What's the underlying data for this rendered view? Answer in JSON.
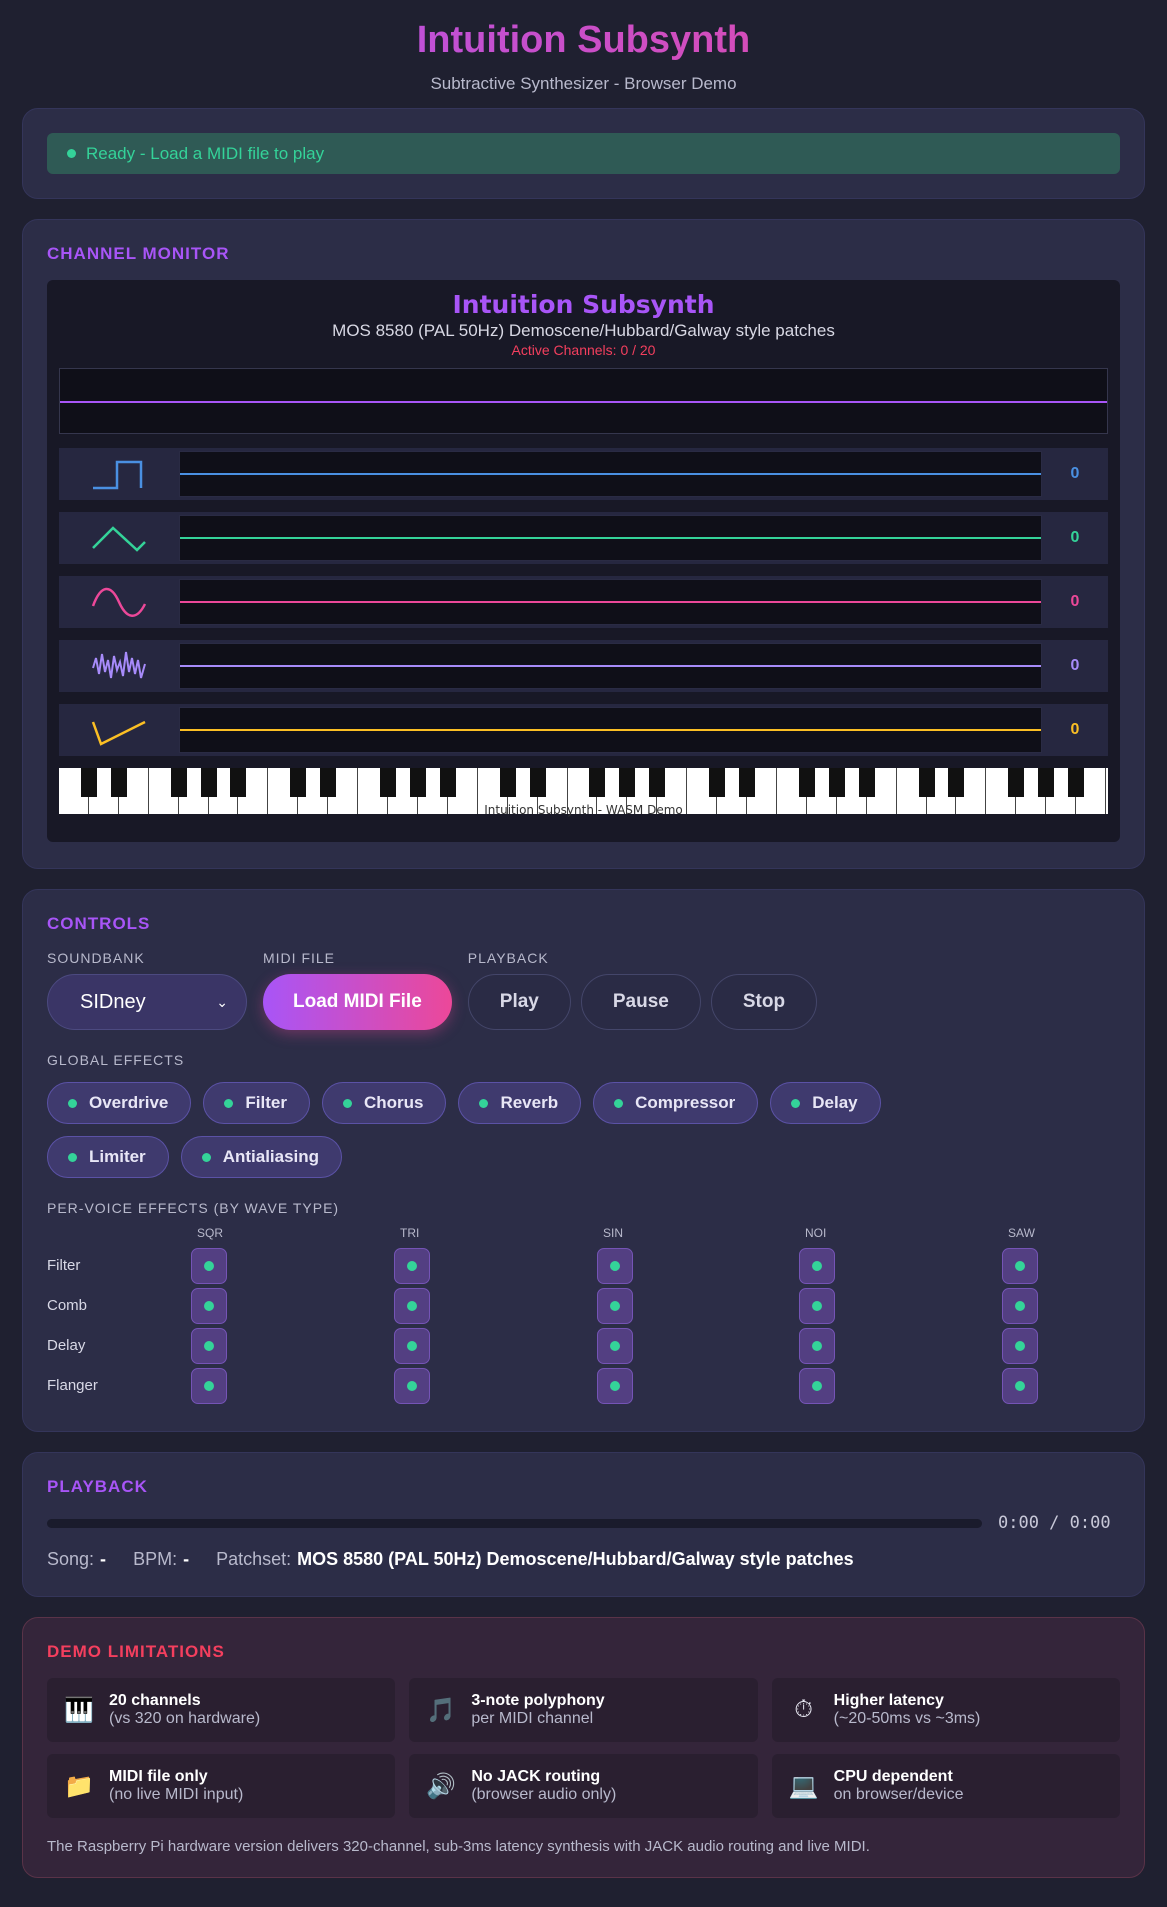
{
  "header": {
    "title": "Intuition Subsynth",
    "subtitle": "Subtractive Synthesizer - Browser Demo"
  },
  "status": {
    "text": "Ready - Load a MIDI file to play",
    "color": "#34d399"
  },
  "monitor": {
    "section_title": "CHANNEL MONITOR",
    "title": "Intuition Subsynth",
    "subtitle": "MOS 8580 (PAL 50Hz) Demoscene/Hubbard/Galway style patches",
    "active": "Active Channels: 0 / 20",
    "channels": [
      {
        "icon": "square-wave-icon",
        "count": "0",
        "color": "#4a90e2"
      },
      {
        "icon": "triangle-wave-icon",
        "count": "0",
        "color": "#34d399"
      },
      {
        "icon": "sine-wave-icon",
        "count": "0",
        "color": "#ec4899"
      },
      {
        "icon": "noise-wave-icon",
        "count": "0",
        "color": "#a78bfa"
      },
      {
        "icon": "saw-wave-icon",
        "count": "0",
        "color": "#fbbf24"
      }
    ],
    "keyboard_label": "Intuition Subsynth - WASM Demo"
  },
  "controls": {
    "section_title": "CONTROLS",
    "soundbank_label": "SOUNDBANK",
    "soundbank_value": "SIDney",
    "midi_label": "MIDI FILE",
    "load_button": "Load MIDI File",
    "playback_label": "PLAYBACK",
    "play": "Play",
    "pause": "Pause",
    "stop": "Stop",
    "global_label": "GLOBAL EFFECTS",
    "global_effects": [
      "Overdrive",
      "Filter",
      "Chorus",
      "Reverb",
      "Compressor",
      "Delay",
      "Limiter",
      "Antialiasing"
    ],
    "pervoice_label": "PER-VOICE EFFECTS (BY WAVE TYPE)",
    "wave_types": [
      "SQR",
      "TRI",
      "SIN",
      "NOI",
      "SAW"
    ],
    "voice_effects": [
      "Filter",
      "Comb",
      "Delay",
      "Flanger"
    ]
  },
  "playback": {
    "section_title": "PLAYBACK",
    "progress": 0,
    "time": "0:00 / 0:00",
    "song_label": "Song:",
    "song_value": "-",
    "bpm_label": "BPM:",
    "bpm_value": "-",
    "patchset_label": "Patchset:",
    "patchset_value": "MOS 8580 (PAL 50Hz) Demoscene/Hubbard/Galway style patches"
  },
  "limitations": {
    "section_title": "DEMO LIMITATIONS",
    "items": [
      {
        "icon": "piano-icon",
        "glyph": "🎹",
        "title": "20 channels",
        "sub": "(vs 320 on hardware)"
      },
      {
        "icon": "music-note-icon",
        "glyph": "🎵",
        "title": "3-note polyphony",
        "sub": "per MIDI channel"
      },
      {
        "icon": "stopwatch-icon",
        "glyph": "⏱",
        "title": "Higher latency",
        "sub": "(~20-50ms vs ~3ms)"
      },
      {
        "icon": "folder-icon",
        "glyph": "📁",
        "title": "MIDI file only",
        "sub": "(no live MIDI input)"
      },
      {
        "icon": "speaker-icon",
        "glyph": "🔊",
        "title": "No JACK routing",
        "sub": "(browser audio only)"
      },
      {
        "icon": "laptop-icon",
        "glyph": "💻",
        "title": "CPU dependent",
        "sub": "on browser/device"
      }
    ],
    "footnote": "The Raspberry Pi hardware version delivers 320-channel, sub-3ms latency synthesis with JACK audio routing and live MIDI."
  }
}
